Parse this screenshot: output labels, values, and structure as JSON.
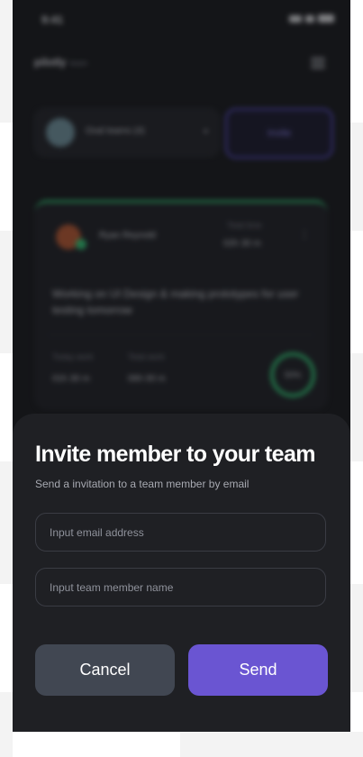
{
  "background_app": {
    "status_time": "9:41",
    "logo": "pilotly",
    "logo_sub": "team",
    "team_name": "Oval teams (4)",
    "invite_label": "Invite",
    "card": {
      "member_name": "Ryan Reynold",
      "tag": "Total time",
      "time": "02h 30 m",
      "description": "Working on UI Design & making prototypes for user testing tomorrow",
      "stats": [
        {
          "label": "Today work",
          "value": "01h 30 m"
        },
        {
          "label": "Total work",
          "value": "06h 00 m"
        }
      ],
      "progress_label": "50%",
      "progress": 0.5
    }
  },
  "sheet": {
    "title": "Invite member to your team",
    "subtitle": "Send a invitation to a team member by email",
    "email_placeholder": "Input email address",
    "name_placeholder": "Input team member name",
    "cancel_label": "Cancel",
    "send_label": "Send"
  },
  "colors": {
    "sheet_bg": "#1f2024",
    "cancel_bg": "#414752",
    "send_bg": "#6a55d2",
    "accent_green": "#2ec271"
  }
}
